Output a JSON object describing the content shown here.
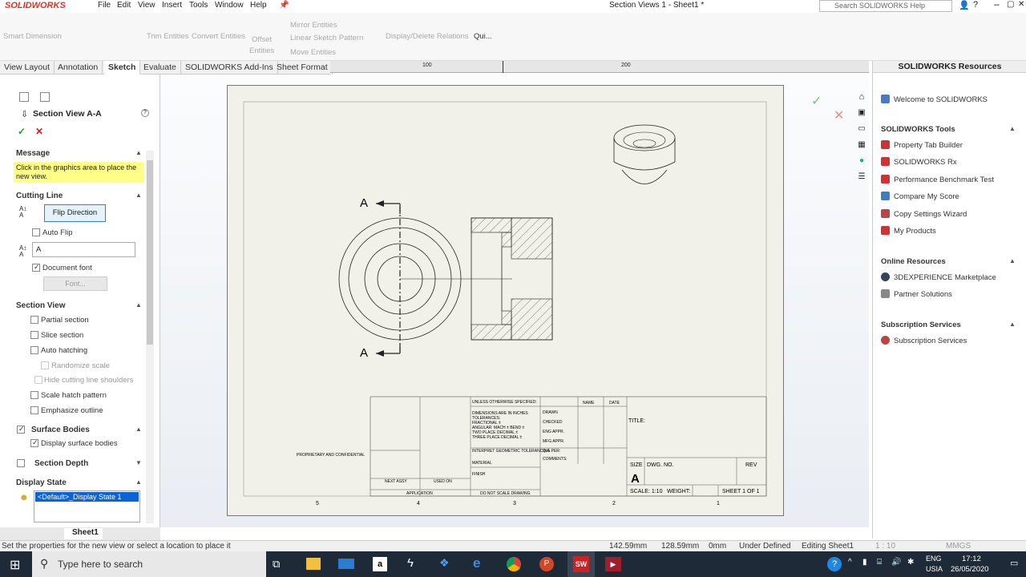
{
  "app": {
    "logo": "SOLIDWORKS",
    "doc_title": "Section Views 1 - Sheet1 *",
    "search_placeholder": "Search SOLIDWORKS Help"
  },
  "menu": [
    "File",
    "Edit",
    "View",
    "Insert",
    "Tools",
    "Window",
    "Help"
  ],
  "ribbon": {
    "smart_dimension": "Smart Dimension",
    "trim": "Trim Entities",
    "convert": "Convert Entities",
    "offset1": "Offset",
    "offset2": "Entities",
    "mirror": "Mirror Entities",
    "linear_pattern": "Linear Sketch Pattern",
    "move": "Move Entities",
    "display_delete": "Display/Delete Relations",
    "quick": "Qui..."
  },
  "tabs": [
    "View Layout",
    "Annotation",
    "Sketch",
    "Evaluate",
    "SOLIDWORKS Add-Ins",
    "Sheet Format"
  ],
  "ruler": {
    "t1": "100",
    "t2": "200"
  },
  "panel": {
    "title": "Section View A-A",
    "message_header": "Message",
    "message_text": "Click in the graphics area to place the new view.",
    "cutting_line": "Cutting Line",
    "flip_direction": "Flip Direction",
    "auto_flip": "Auto Flip",
    "label_value": "A",
    "document_font": "Document font",
    "font_btn": "Font...",
    "section_view": "Section View",
    "partial": "Partial section",
    "slice": "Slice section",
    "auto_hatching": "Auto hatching",
    "randomize": "Randomize scale",
    "hide_shoulders": "Hide cutting line shoulders",
    "scale_hatch": "Scale hatch pattern",
    "emphasize": "Emphasize outline",
    "surface_bodies": "Surface Bodies",
    "display_surface": "Display surface bodies",
    "section_depth": "Section Depth",
    "display_state": "Display State",
    "display_state_item": "<Default>_Display State 1"
  },
  "sheet_tab": "Sheet1",
  "drawing": {
    "label_a": "A",
    "zones": [
      "5",
      "4",
      "3",
      "2",
      "1"
    ],
    "unless": "UNLESS OTHERWISE SPECIFIED:",
    "name": "NAME",
    "date": "DATE",
    "drawn": "DRAWN",
    "checked": "CHECKED",
    "eng": "ENG APPR.",
    "mfg": "MFG APPR.",
    "qa": "Q.A.",
    "comments": "COMMENTS:",
    "title": "TITLE:",
    "size": "SIZE",
    "size_val": "A",
    "dwg": "DWG.  NO.",
    "rev": "REV",
    "scale": "SCALE: 1:10",
    "weight": "WEIGHT:",
    "sheet": "SHEET 1 OF 1",
    "application": "APPLICATION",
    "do_not_scale": "DO NOT SCALE DRAWING",
    "next_assy": "NEXT ASSY",
    "used_on": "USED ON",
    "material": "MATERIAL",
    "finish": "FINISH",
    "proprietary": "PROPRIETARY AND CONFIDENTIAL",
    "dims": "DIMENSIONS ARE IN INCHES",
    "tolerances": "TOLERANCES:",
    "fractional": "FRACTIONAL ±",
    "angular": "ANGULAR: MACH ±   BEND ±",
    "two_place": "TWO PLACE DECIMAL   ±",
    "three_place": "THREE PLACE DECIMAL  ±",
    "interpret": "INTERPRET GEOMETRIC TOLERANCING PER:"
  },
  "taskpane": {
    "header": "SOLIDWORKS Resources",
    "welcome": "Welcome to SOLIDWORKS",
    "tools_header": "SOLIDWORKS Tools",
    "tools": [
      "Property Tab Builder",
      "SOLIDWORKS Rx",
      "Performance Benchmark Test",
      "Compare My Score",
      "Copy Settings Wizard",
      "My Products"
    ],
    "online_header": "Online Resources",
    "online": [
      "3DEXPERIENCE Marketplace",
      "Partner Solutions"
    ],
    "sub_header": "Subscription Services",
    "sub": [
      "Subscription Services"
    ]
  },
  "status": {
    "message": "Set the properties for the new view or select a location to place it",
    "x": "142.59mm",
    "y": "128.59mm",
    "z": "0mm",
    "state": "Under Defined",
    "editing": "Editing Sheet1",
    "scale": "1 : 10",
    "units": "MMGS"
  },
  "taskbar": {
    "search": "Type here to search",
    "lang1": "ENG",
    "lang2": "USIA",
    "time": "17:12",
    "date": "26/05/2020"
  },
  "colors": {
    "accent": "#d32f2f",
    "selection": "#0a64d8",
    "highlight": "#ffff88",
    "taskbar": "#1f2a38"
  }
}
